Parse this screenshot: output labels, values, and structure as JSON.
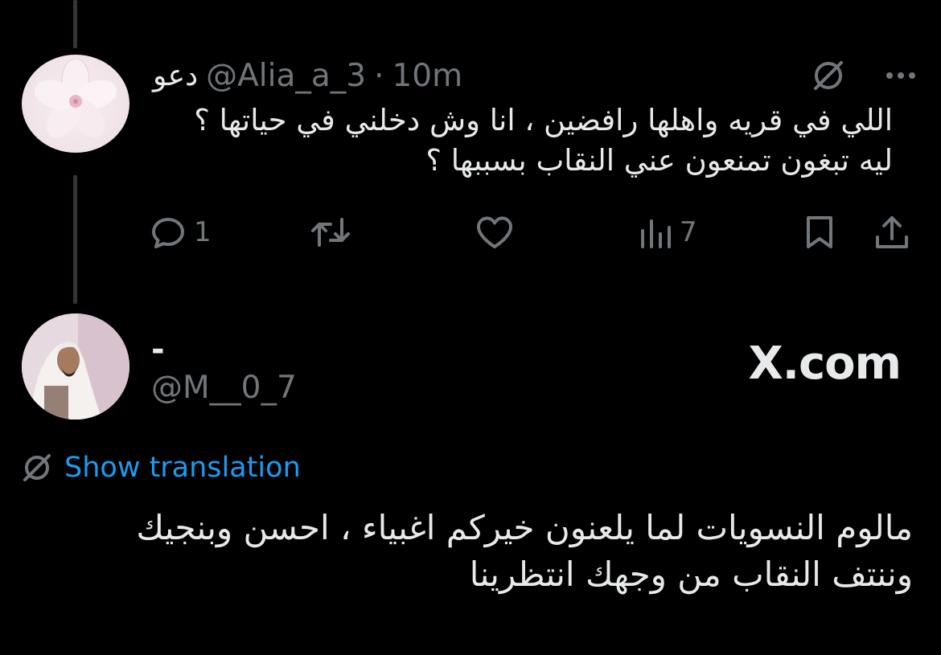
{
  "tweet1": {
    "display_name": "دعو",
    "handle": "@Alia_a_3",
    "separator": "·",
    "time": "10m",
    "text_line1": "اللي في قريه واهلها رافضين ، انا وش دخلني في حياتها ؟",
    "text_line2": "ليه تبغون تمنعون عني النقاب بسببها ؟",
    "replies": "1",
    "views": "7"
  },
  "tweet2": {
    "display_name": "-",
    "handle": "@M__0_7",
    "watermark": "X.com",
    "show_translation": "Show translation",
    "text_line1": "مالوم النسويات لما يلعنون خيركم اغبياء ، احسن وبنجيك",
    "text_line2": "وننتف النقاب من وجهك انتظرينا"
  },
  "colors": {
    "background": "#000000",
    "text_primary": "#e7e9ea",
    "text_secondary": "#71767b",
    "link": "#1d9bf0"
  },
  "icons": [
    "grok-icon",
    "more-icon",
    "reply-icon",
    "retweet-icon",
    "like-icon",
    "views-icon",
    "bookmark-icon",
    "share-icon",
    "translate-icon"
  ]
}
